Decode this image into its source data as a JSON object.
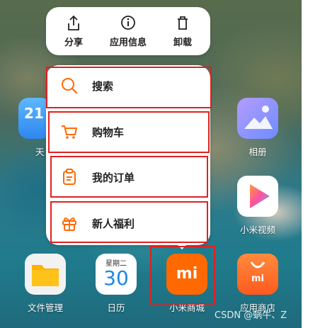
{
  "quick_actions": [
    {
      "label": "分享",
      "icon": "share-icon"
    },
    {
      "label": "应用信息",
      "icon": "info-icon"
    },
    {
      "label": "卸载",
      "icon": "trash-icon"
    }
  ],
  "menu_items": [
    {
      "label": "搜索",
      "icon": "search-icon"
    },
    {
      "label": "购物车",
      "icon": "cart-icon"
    },
    {
      "label": "我的订单",
      "icon": "clipboard-icon"
    },
    {
      "label": "新人福利",
      "icon": "gift-icon"
    }
  ],
  "apps": {
    "left_partial": {
      "name": "天",
      "date": "21"
    },
    "album": {
      "name": "相册"
    },
    "video": {
      "name": "小米视频"
    },
    "files": {
      "name": "文件管理"
    },
    "calendar": {
      "name": "日历",
      "weekday": "星期二",
      "day": "30"
    },
    "mi_store": {
      "name": "小米商城",
      "logo": "mi"
    },
    "app_store": {
      "name": "应用商店",
      "logo": "mi"
    }
  },
  "watermark": "CSDN @蜗牛、Z",
  "colors": {
    "accent": "#ff6900",
    "highlight": "#e02020"
  }
}
